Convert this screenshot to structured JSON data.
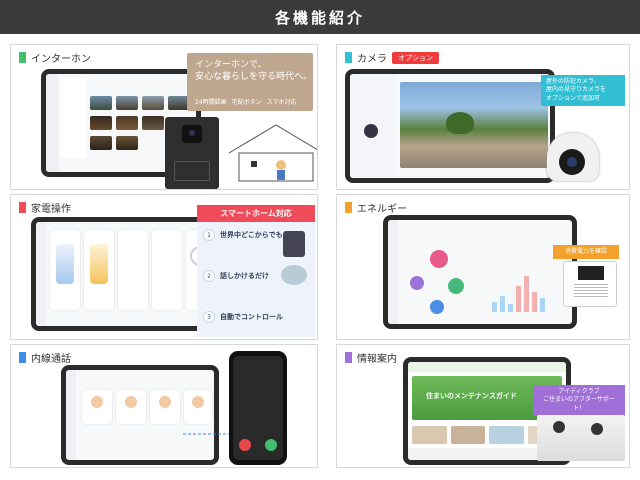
{
  "header": {
    "title": "各機能紹介"
  },
  "colors": {
    "header_bg": "#3b3b3b",
    "intercom": "#43c06a",
    "camera": "#33bfd3",
    "appliance": "#ef4b5b",
    "energy": "#f3a12d",
    "extension": "#3a8ee6",
    "info": "#a070d8"
  },
  "intercom": {
    "title": "インターホン",
    "banner": "インターホンで、\n安心な暮らしを守る時代へ。",
    "features": [
      "24時間録画",
      "宅配ボタン",
      "スマホ対応"
    ]
  },
  "camera": {
    "title": "カメラ",
    "badge": "オプション",
    "callout": "屋外の防犯カメラ、\n屋内の見守りカメラを\nオプションで追加可"
  },
  "appliance": {
    "title": "家電操作",
    "smarthome_title": "スマートホーム対応",
    "steps": [
      {
        "num": "1",
        "text": "世界中どこからでも"
      },
      {
        "num": "2",
        "text": "話しかけるだけ"
      },
      {
        "num": "3",
        "text": "自動でコントロール"
      }
    ]
  },
  "energy": {
    "title": "エネルギー",
    "callout": "消費電力を確認"
  },
  "extension": {
    "title": "内線通話"
  },
  "info": {
    "title": "情報案内",
    "callout": "アイディクラブ\nご住まいのアフターサポート！",
    "banner": "住まいのメンテナンスガイド"
  }
}
